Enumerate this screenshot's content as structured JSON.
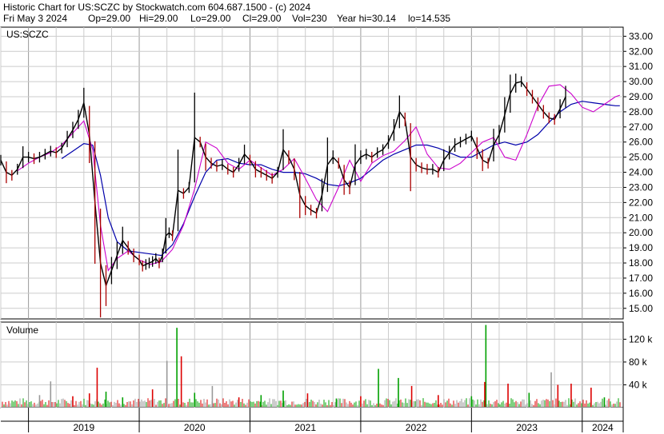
{
  "header": {
    "title": "Historic Chart for US:SCZC by Stockwatch.com 604.687.1500 - (c) 2024",
    "date": "Fri May  3 2024",
    "open": "Op=29.00",
    "high": "Hi=29.00",
    "low": "Lo=29.00",
    "close": "Cl=29.00",
    "volume": "Vol=230",
    "year_high": "Year hi=30.14",
    "year_low": "lo=14.535"
  },
  "colors": {
    "price": "#000000",
    "ma_short": "#cc00cc",
    "ma_long": "#0000aa",
    "vol_up": "#00a000",
    "vol_down": "#dd0000",
    "vol_flat": "#999999",
    "grid": "#cccccc"
  },
  "chart_data": [
    {
      "type": "line",
      "symbol": "US:SCZC",
      "x_ticks": [
        "2019",
        "2020",
        "2021",
        "2022",
        "2023",
        "2024"
      ],
      "y_ticks": [
        "15.00",
        "16.00",
        "17.00",
        "18.00",
        "19.00",
        "20.00",
        "21.00",
        "22.00",
        "23.00",
        "24.00",
        "25.00",
        "26.00",
        "27.00",
        "28.00",
        "29.00",
        "30.00",
        "31.00",
        "32.00",
        "33.00"
      ],
      "ylim": [
        14.3,
        33.6
      ],
      "xlim": [
        2018.75,
        2024.37
      ],
      "grid": true,
      "series": [
        {
          "x": [
            2018.75,
            2018.8,
            2018.85,
            2018.9,
            2018.95,
            2019.0,
            2019.05,
            2019.1,
            2019.15,
            2019.2,
            2019.25,
            2019.3,
            2019.35,
            2019.4,
            2019.45,
            2019.5,
            2019.55,
            2019.6,
            2019.65,
            2019.7,
            2019.75,
            2019.8,
            2019.85,
            2019.9,
            2019.95,
            2020.0,
            2020.03,
            2020.06,
            2020.09,
            2020.12,
            2020.15,
            2020.18,
            2020.21,
            2020.24,
            2020.27,
            2020.3,
            2020.35,
            2020.4,
            2020.45,
            2020.5,
            2020.55,
            2020.6,
            2020.65,
            2020.7,
            2020.75,
            2020.8,
            2020.85,
            2020.9,
            2020.95,
            2021.0,
            2021.05,
            2021.1,
            2021.15,
            2021.2,
            2021.25,
            2021.3,
            2021.35,
            2021.4,
            2021.45,
            2021.5,
            2021.55,
            2021.6,
            2021.65,
            2021.7,
            2021.75,
            2021.8,
            2021.85,
            2021.9,
            2021.95,
            2022.0,
            2022.05,
            2022.1,
            2022.15,
            2022.2,
            2022.25,
            2022.3,
            2022.35,
            2022.4,
            2022.45,
            2022.5,
            2022.55,
            2022.6,
            2022.65,
            2022.7,
            2022.75,
            2022.8,
            2022.85,
            2022.9,
            2022.95,
            2023.0,
            2023.05,
            2023.1,
            2023.15,
            2023.2,
            2023.25,
            2023.3,
            2023.35,
            2023.4,
            2023.45,
            2023.5,
            2023.55,
            2023.6,
            2023.65,
            2023.7,
            2023.75,
            2023.8,
            2023.85,
            2023.9,
            2023.95,
            2024.0,
            2024.05,
            2024.1,
            2024.15,
            2024.2,
            2024.25,
            2024.3,
            2024.34
          ],
          "close": [
            24.8,
            24.0,
            23.8,
            24.2,
            25.0,
            25.0,
            24.9,
            25.0,
            25.2,
            25.4,
            25.3,
            25.6,
            26.2,
            26.8,
            27.5,
            28.6,
            26.5,
            22.0,
            18.0,
            16.5,
            17.5,
            18.5,
            19.5,
            19.0,
            18.5,
            18.2,
            17.8,
            17.9,
            18.0,
            18.1,
            18.3,
            18.0,
            18.5,
            19.8,
            20.0,
            19.8,
            22.8,
            22.6,
            23.0,
            26.3,
            26.0,
            25.0,
            24.6,
            24.4,
            24.5,
            24.2,
            24.0,
            24.5,
            25.2,
            24.8,
            24.2,
            24.0,
            23.8,
            23.6,
            24.0,
            25.5,
            25.0,
            24.2,
            22.5,
            21.8,
            21.5,
            21.3,
            22.5,
            24.5,
            25.0,
            24.6,
            23.5,
            23.0,
            24.5,
            25.0,
            25.2,
            25.0,
            25.3,
            25.5,
            26.0,
            26.8,
            28.0,
            27.5,
            25.0,
            24.5,
            24.3,
            24.2,
            24.2,
            24.0,
            24.8,
            25.3,
            25.8,
            26.0,
            26.2,
            26.4,
            25.6,
            24.8,
            24.6,
            25.8,
            26.5,
            27.8,
            29.2,
            29.9,
            30.0,
            29.5,
            29.0,
            28.5,
            28.0,
            27.6,
            27.5,
            28.2,
            29.0
          ]
        }
      ],
      "ma_short": {
        "x": [
          2018.9,
          2019.0,
          2019.1,
          2019.2,
          2019.3,
          2019.4,
          2019.5,
          2019.58,
          2019.65,
          2019.72,
          2019.8,
          2019.9,
          2020.0,
          2020.1,
          2020.2,
          2020.3,
          2020.4,
          2020.5,
          2020.6,
          2020.7,
          2020.8,
          2020.9,
          2021.0,
          2021.1,
          2021.2,
          2021.3,
          2021.4,
          2021.5,
          2021.6,
          2021.7,
          2021.8,
          2021.9,
          2022.0,
          2022.1,
          2022.2,
          2022.3,
          2022.4,
          2022.5,
          2022.6,
          2022.7,
          2022.8,
          2022.9,
          2023.0,
          2023.1,
          2023.2,
          2023.3,
          2023.4,
          2023.5,
          2023.6,
          2023.7,
          2023.8,
          2023.9,
          2024.0,
          2024.1,
          2024.2,
          2024.3,
          2024.34
        ],
        "values": [
          24.1,
          24.6,
          25.0,
          25.3,
          25.8,
          26.6,
          27.4,
          25.5,
          20.5,
          17.5,
          18.3,
          18.8,
          18.2,
          17.9,
          18.1,
          18.9,
          20.5,
          22.9,
          26.0,
          25.6,
          24.6,
          24.2,
          24.8,
          24.3,
          23.8,
          24.2,
          24.9,
          23.6,
          22.2,
          21.4,
          23.0,
          24.8,
          23.4,
          24.6,
          25.1,
          25.4,
          26.1,
          27.0,
          25.2,
          24.3,
          24.2,
          24.6,
          25.3,
          26.0,
          26.3,
          25.0,
          24.8,
          26.5,
          28.4,
          29.7,
          29.8,
          29.2,
          28.3,
          28.0,
          28.5,
          29.0,
          29.1
        ]
      },
      "ma_long": {
        "x": [
          2019.3,
          2019.4,
          2019.5,
          2019.58,
          2019.65,
          2019.72,
          2019.8,
          2019.9,
          2020.0,
          2020.1,
          2020.2,
          2020.3,
          2020.4,
          2020.5,
          2020.6,
          2020.7,
          2020.8,
          2020.9,
          2021.0,
          2021.1,
          2021.2,
          2021.3,
          2021.4,
          2021.5,
          2021.6,
          2021.7,
          2021.8,
          2021.9,
          2022.0,
          2022.1,
          2022.2,
          2022.3,
          2022.4,
          2022.5,
          2022.6,
          2022.7,
          2022.8,
          2022.9,
          2023.0,
          2023.1,
          2023.2,
          2023.3,
          2023.4,
          2023.5,
          2023.6,
          2023.7,
          2023.8,
          2023.9,
          2024.0,
          2024.1,
          2024.2,
          2024.3,
          2024.34
        ],
        "values": [
          24.9,
          25.4,
          25.9,
          25.8,
          23.8,
          21.0,
          19.4,
          18.8,
          18.7,
          18.6,
          18.5,
          19.2,
          20.6,
          22.4,
          24.0,
          24.8,
          24.9,
          24.6,
          24.5,
          24.5,
          24.2,
          24.0,
          24.0,
          23.9,
          23.6,
          23.2,
          23.1,
          23.3,
          23.6,
          24.2,
          24.8,
          25.2,
          25.5,
          25.8,
          25.8,
          25.6,
          25.3,
          25.0,
          25.0,
          25.4,
          25.8,
          26.0,
          25.8,
          26.0,
          26.5,
          27.3,
          28.0,
          28.5,
          28.7,
          28.6,
          28.5,
          28.4,
          28.4
        ]
      }
    },
    {
      "type": "bar",
      "title": "Volume",
      "y_ticks": [
        "40 k",
        "80 k",
        "120 k"
      ],
      "ylim": [
        0,
        150
      ],
      "value_unit": "thousands",
      "spikes": [
        {
          "x": 2019.1,
          "v": 22,
          "dir": "flat"
        },
        {
          "x": 2019.2,
          "v": 46,
          "dir": "flat"
        },
        {
          "x": 2019.4,
          "v": 20,
          "dir": "down"
        },
        {
          "x": 2019.55,
          "v": 25,
          "dir": "down"
        },
        {
          "x": 2019.62,
          "v": 70,
          "dir": "down"
        },
        {
          "x": 2019.7,
          "v": 28,
          "dir": "up"
        },
        {
          "x": 2019.85,
          "v": 18,
          "dir": "up"
        },
        {
          "x": 2020.12,
          "v": 32,
          "dir": "down"
        },
        {
          "x": 2020.25,
          "v": 82,
          "dir": "flat"
        },
        {
          "x": 2020.34,
          "v": 140,
          "dir": "up"
        },
        {
          "x": 2020.38,
          "v": 90,
          "dir": "down"
        },
        {
          "x": 2020.5,
          "v": 26,
          "dir": "up"
        },
        {
          "x": 2020.66,
          "v": 38,
          "dir": "flat"
        },
        {
          "x": 2020.9,
          "v": 18,
          "dir": "down"
        },
        {
          "x": 2021.1,
          "v": 22,
          "dir": "up"
        },
        {
          "x": 2021.3,
          "v": 30,
          "dir": "up"
        },
        {
          "x": 2021.52,
          "v": 25,
          "dir": "down"
        },
        {
          "x": 2021.78,
          "v": 16,
          "dir": "up"
        },
        {
          "x": 2022.0,
          "v": 20,
          "dir": "down"
        },
        {
          "x": 2022.16,
          "v": 68,
          "dir": "up"
        },
        {
          "x": 2022.34,
          "v": 52,
          "dir": "up"
        },
        {
          "x": 2022.46,
          "v": 38,
          "dir": "down"
        },
        {
          "x": 2022.7,
          "v": 22,
          "dir": "down"
        },
        {
          "x": 2023.0,
          "v": 20,
          "dir": "up"
        },
        {
          "x": 2023.13,
          "v": 145,
          "dir": "up"
        },
        {
          "x": 2023.12,
          "v": 45,
          "dir": "down"
        },
        {
          "x": 2023.33,
          "v": 42,
          "dir": "down"
        },
        {
          "x": 2023.52,
          "v": 26,
          "dir": "up"
        },
        {
          "x": 2023.72,
          "v": 62,
          "dir": "flat"
        },
        {
          "x": 2023.78,
          "v": 40,
          "dir": "down"
        },
        {
          "x": 2023.9,
          "v": 42,
          "dir": "down"
        },
        {
          "x": 2024.08,
          "v": 35,
          "dir": "down"
        },
        {
          "x": 2024.2,
          "v": 18,
          "dir": "up"
        }
      ]
    }
  ]
}
